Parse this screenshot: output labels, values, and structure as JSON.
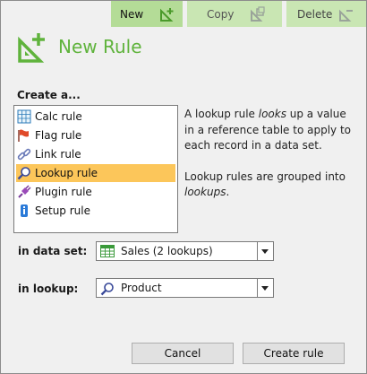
{
  "toolbar": {
    "new_label": "New",
    "copy_label": "Copy",
    "delete_label": "Delete"
  },
  "dialog": {
    "title": "New Rule",
    "create_label": "Create a...",
    "rule_types": [
      {
        "label": "Calc rule",
        "icon": "calc-icon",
        "selected": false
      },
      {
        "label": "Flag rule",
        "icon": "flag-icon",
        "selected": false
      },
      {
        "label": "Link rule",
        "icon": "link-icon",
        "selected": false
      },
      {
        "label": "Lookup rule",
        "icon": "magnifier-icon",
        "selected": true
      },
      {
        "label": "Plugin rule",
        "icon": "plugin-icon",
        "selected": false
      },
      {
        "label": "Setup rule",
        "icon": "setup-icon",
        "selected": false
      }
    ],
    "description": {
      "p1_a": "A lookup rule ",
      "p1_em": "looks",
      "p1_b": " up a value in a reference table to apply to each record in a data set.",
      "p2_a": "Lookup rules are grouped into ",
      "p2_em": "lookups",
      "p2_b": "."
    },
    "dataset_label": "in data set:",
    "dataset_value": "Sales (2 lookups)",
    "lookup_label": "in lookup:",
    "lookup_value": "Product",
    "cancel_label": "Cancel",
    "create_button_label": "Create rule"
  },
  "colors": {
    "accent": "#5fb33c",
    "toolbar_bg": "#c9e6b3",
    "selection": "#fcc65a"
  }
}
